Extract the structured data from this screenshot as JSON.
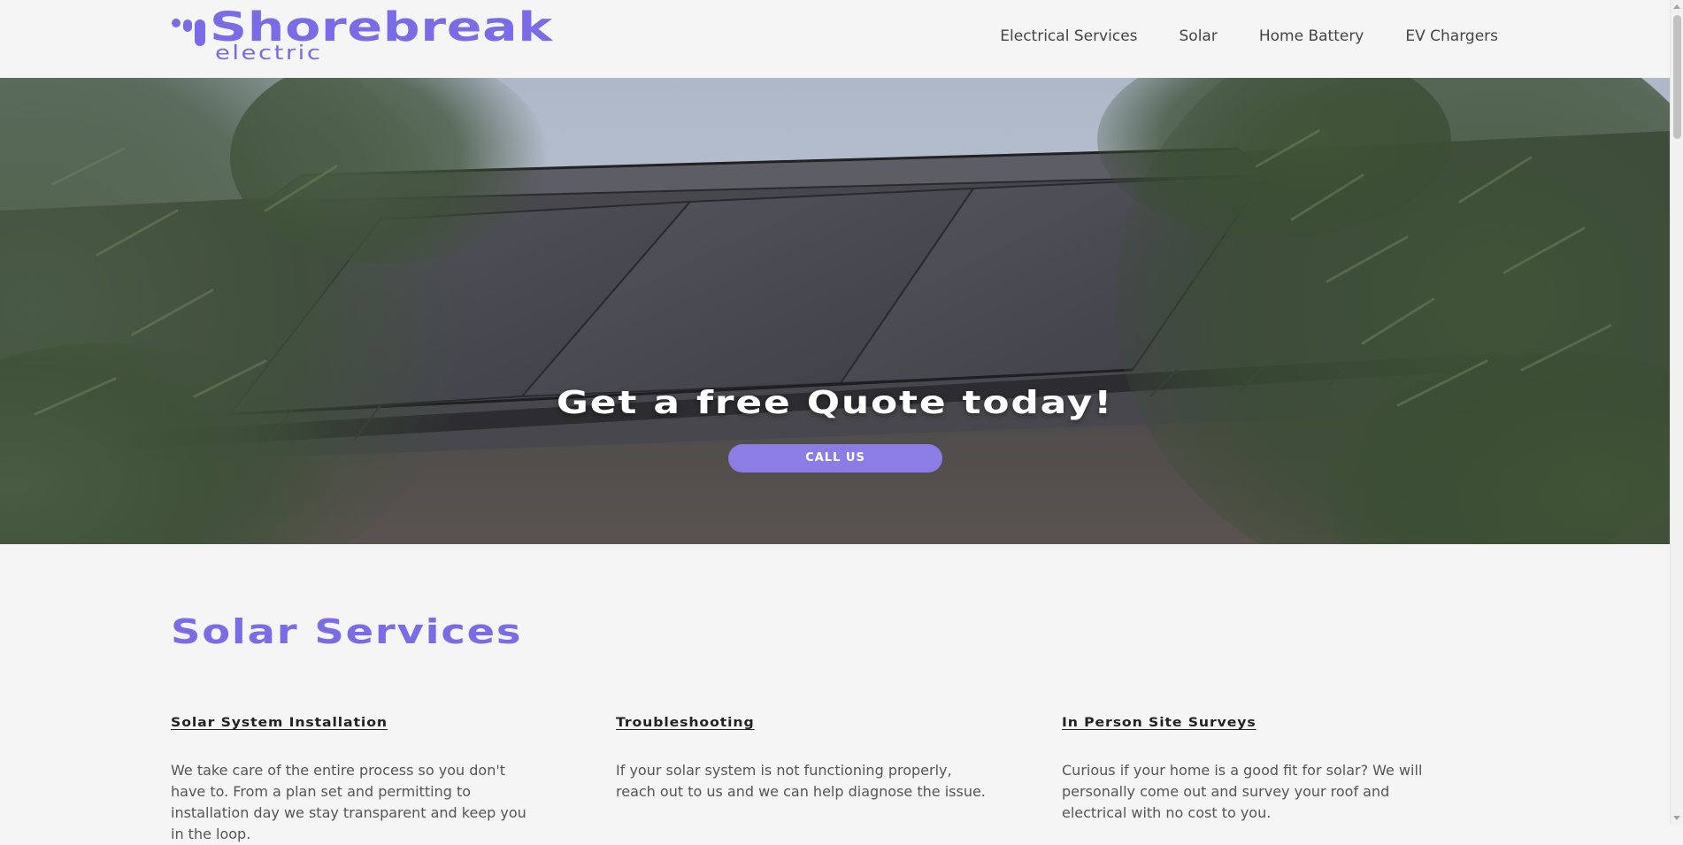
{
  "brand": {
    "name": "Shorebreak",
    "sub": "electric",
    "accent_color": "#7a6be6"
  },
  "nav": {
    "items": [
      {
        "label": "Electrical Services"
      },
      {
        "label": "Solar"
      },
      {
        "label": "Home Battery"
      },
      {
        "label": "EV Chargers"
      }
    ]
  },
  "hero": {
    "title": "Get a free Quote today!",
    "cta_label": "CALL US",
    "cta_color": "#8c7ce6"
  },
  "services": {
    "title": "Solar Services",
    "items": [
      {
        "title": "Solar System Installation",
        "description": "We take care of the entire process so you don't have to. From a plan set and permitting to installation day we stay transparent and keep you in the loop."
      },
      {
        "title": "Troubleshooting",
        "description": "If your solar system is not functioning properly, reach out to us and we can help diagnose the issue."
      },
      {
        "title": "In Person Site Surveys",
        "description": "Curious if your home is a good fit for solar? We will personally come out and survey your roof and electrical with no cost to you."
      }
    ]
  }
}
